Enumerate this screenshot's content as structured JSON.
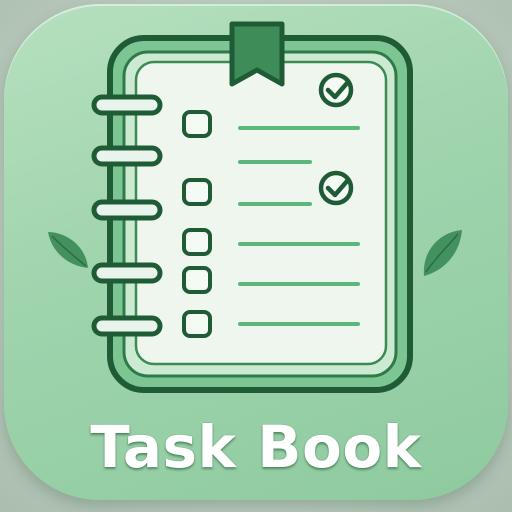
{
  "app": {
    "name": "Task Book"
  },
  "icons": {
    "notebook": "notebook-icon",
    "bookmark": "bookmark-icon",
    "check": "check-circle-icon",
    "leaf": "leaf-icon"
  },
  "checklist": {
    "items": [
      {
        "checked": false,
        "checkmark_shown": true
      },
      {
        "checked": false,
        "checkmark_shown": false
      },
      {
        "checked": false,
        "checkmark_shown": true
      },
      {
        "checked": false,
        "checkmark_shown": false
      },
      {
        "checked": false,
        "checkmark_shown": false
      },
      {
        "checked": false,
        "checkmark_shown": false
      }
    ]
  },
  "colors": {
    "background_outer": "#b9c9bc",
    "icon_tile": "#9fd4ad",
    "stroke_dark": "#1f5c36",
    "stroke_mid": "#2f7a48",
    "page": "#eef6ee",
    "line": "#5cb77b",
    "title": "#ffffff"
  }
}
